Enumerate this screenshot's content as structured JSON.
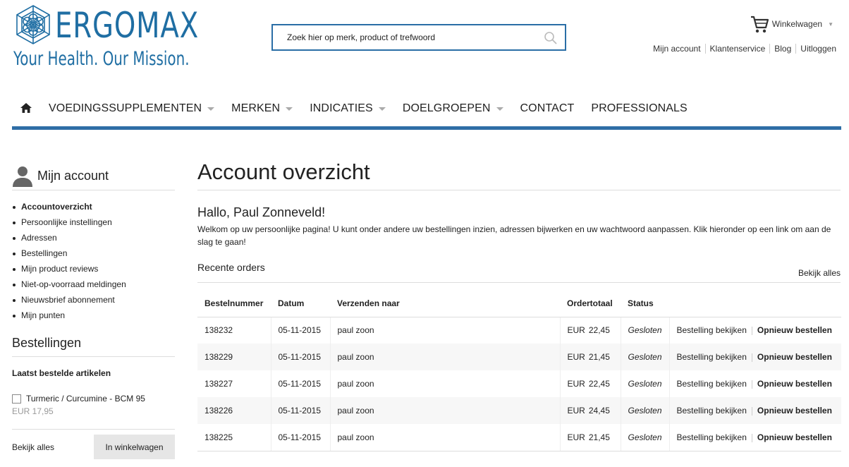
{
  "brand": {
    "name": "ERGOMAX",
    "tagline": "Your Health. Our Mission."
  },
  "search": {
    "placeholder": "Zoek hier op merk, product of trefwoord",
    "icon": "search-icon"
  },
  "cart": {
    "label": "Winkelwagen",
    "icon": "cart-icon"
  },
  "toplinks": [
    "Mijn account",
    "Klantenservice",
    "Blog",
    "Uitloggen"
  ],
  "nav": {
    "home_icon": "home-icon",
    "items": [
      {
        "label": "VOEDINGSSUPPLEMENTEN",
        "dropdown": true
      },
      {
        "label": "MERKEN",
        "dropdown": true
      },
      {
        "label": "INDICATIES",
        "dropdown": true
      },
      {
        "label": "DOELGROEPEN",
        "dropdown": true
      },
      {
        "label": "CONTACT",
        "dropdown": false
      },
      {
        "label": "PROFESSIONALS",
        "dropdown": false
      }
    ],
    "accent_color": "#2f6ea6"
  },
  "sidebar": {
    "title": "Mijn account",
    "menu": [
      {
        "label": "Accountoverzicht",
        "active": true
      },
      {
        "label": "Persoonlijke instellingen",
        "active": false
      },
      {
        "label": "Adressen",
        "active": false
      },
      {
        "label": "Bestellingen",
        "active": false
      },
      {
        "label": "Mijn product reviews",
        "active": false
      },
      {
        "label": "Niet-op-voorraad meldingen",
        "active": false
      },
      {
        "label": "Nieuwsbrief abonnement",
        "active": false
      },
      {
        "label": "Mijn punten",
        "active": false
      }
    ],
    "orders_title": "Bestellingen",
    "last_ordered_title": "Laatst bestelde artikelen",
    "product": {
      "name": "Turmeric / Curcumine - BCM 95",
      "price": "EUR  17,95"
    },
    "view_all": "Bekijk alles",
    "add_to_cart": "In winkelwagen"
  },
  "main": {
    "title": "Account overzicht",
    "greeting": "Hallo, Paul Zonneveld!",
    "intro": "Welkom op uw persoonlijke pagina! U kunt onder andere uw bestellingen inzien, adressen bijwerken en uw wachtwoord aanpassen. Klik hieronder op een link om aan de slag te gaan!",
    "recent_orders_title": "Recente orders",
    "view_all": "Bekijk alles",
    "table": {
      "headers": [
        "Bestelnummer",
        "Datum",
        "Verzenden naar",
        "Ordertotaal",
        "Status",
        ""
      ],
      "rows": [
        {
          "number": "138232",
          "date": "05-11-2015",
          "ship_to": "paul zoon",
          "currency": "EUR",
          "total": "22,45",
          "status": "Gesloten",
          "view": "Bestelling bekijken",
          "reorder": "Opnieuw bestellen"
        },
        {
          "number": "138229",
          "date": "05-11-2015",
          "ship_to": "paul zoon",
          "currency": "EUR",
          "total": "21,45",
          "status": "Gesloten",
          "view": "Bestelling bekijken",
          "reorder": "Opnieuw bestellen"
        },
        {
          "number": "138227",
          "date": "05-11-2015",
          "ship_to": "paul zoon",
          "currency": "EUR",
          "total": "22,45",
          "status": "Gesloten",
          "view": "Bestelling bekijken",
          "reorder": "Opnieuw bestellen"
        },
        {
          "number": "138226",
          "date": "05-11-2015",
          "ship_to": "paul zoon",
          "currency": "EUR",
          "total": "24,45",
          "status": "Gesloten",
          "view": "Bestelling bekijken",
          "reorder": "Opnieuw bestellen"
        },
        {
          "number": "138225",
          "date": "05-11-2015",
          "ship_to": "paul zoon",
          "currency": "EUR",
          "total": "21,45",
          "status": "Gesloten",
          "view": "Bestelling bekijken",
          "reorder": "Opnieuw bestellen"
        }
      ]
    }
  }
}
